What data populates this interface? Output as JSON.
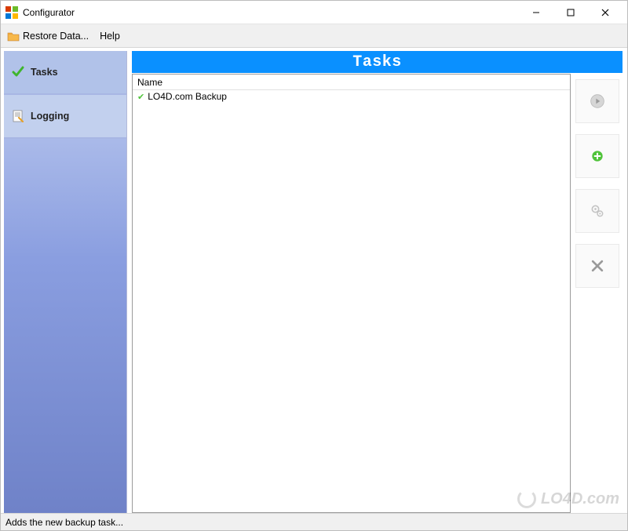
{
  "window": {
    "title": "Configurator"
  },
  "menubar": {
    "restore": "Restore Data...",
    "help": "Help"
  },
  "sidebar": {
    "items": [
      {
        "label": "Tasks"
      },
      {
        "label": "Logging"
      }
    ]
  },
  "main": {
    "header": "Tasks",
    "list": {
      "column": "Name",
      "rows": [
        {
          "label": "LO4D.com Backup"
        }
      ]
    }
  },
  "statusbar": "Adds the new backup task...",
  "watermark": "LO4D.com"
}
